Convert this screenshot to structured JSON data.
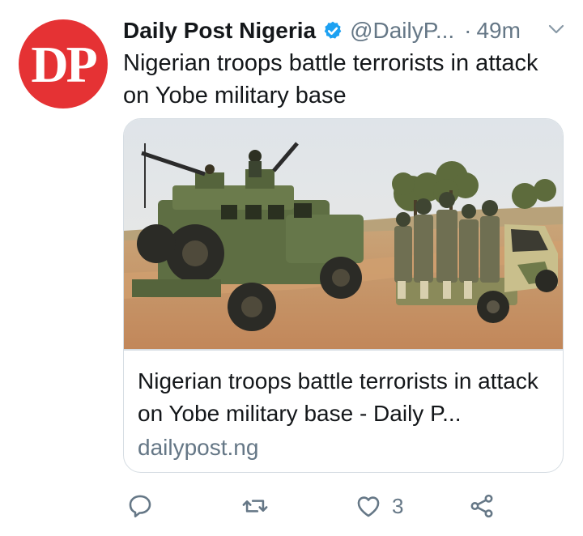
{
  "avatar": {
    "text": "DP",
    "color": "#e53234"
  },
  "header": {
    "name": "Daily Post Nigeria",
    "verified_icon": "verified-badge-icon",
    "handle": "@DailyP...",
    "separator": "·",
    "time": "49m",
    "menu_icon": "chevron-down-icon"
  },
  "tweet": {
    "text": "Nigerian troops battle terrorists in attack on Yobe military base"
  },
  "card": {
    "image_alt": "military vehicles and soldiers on a dirt road",
    "title": "Nigerian troops battle terrorists in attack on Yobe military base - Daily P...",
    "domain": "dailypost.ng"
  },
  "actions": {
    "reply": {
      "icon": "reply-icon"
    },
    "retweet": {
      "icon": "retweet-icon"
    },
    "like": {
      "icon": "heart-icon",
      "count": "3"
    },
    "share": {
      "icon": "share-icon"
    }
  },
  "colors": {
    "verified": "#1da1f2",
    "muted": "#657786",
    "text": "#14171a",
    "border": "#d6dde3"
  }
}
